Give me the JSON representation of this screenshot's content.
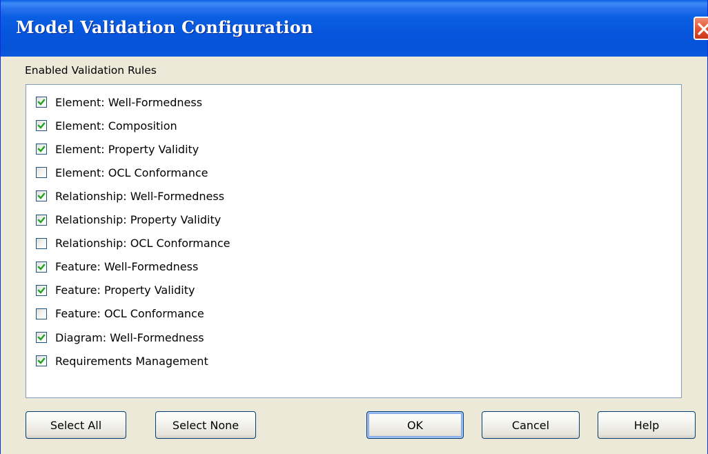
{
  "window": {
    "title": "Model Validation Configuration"
  },
  "section_label": "Enabled Validation Rules",
  "rules": [
    {
      "label": "Element: Well-Formedness",
      "checked": true
    },
    {
      "label": "Element: Composition",
      "checked": true
    },
    {
      "label": "Element: Property Validity",
      "checked": true
    },
    {
      "label": "Element: OCL Conformance",
      "checked": false
    },
    {
      "label": "Relationship: Well-Formedness",
      "checked": true
    },
    {
      "label": "Relationship: Property Validity",
      "checked": true
    },
    {
      "label": "Relationship: OCL Conformance",
      "checked": false
    },
    {
      "label": "Feature: Well-Formedness",
      "checked": true
    },
    {
      "label": "Feature: Property Validity",
      "checked": true
    },
    {
      "label": "Feature: OCL Conformance",
      "checked": false
    },
    {
      "label": "Diagram: Well-Formedness",
      "checked": true
    },
    {
      "label": "Requirements Management",
      "checked": true
    }
  ],
  "buttons": {
    "select_all": "Select All",
    "select_none": "Select None",
    "ok": "OK",
    "cancel": "Cancel",
    "help": "Help"
  },
  "icons": {
    "close": "close-icon",
    "check": "checkmark-icon"
  },
  "colors": {
    "titlebar": "#0554d8",
    "close_button": "#e1522f",
    "check": "#21a121",
    "dialog_bg": "#ece9d8"
  }
}
